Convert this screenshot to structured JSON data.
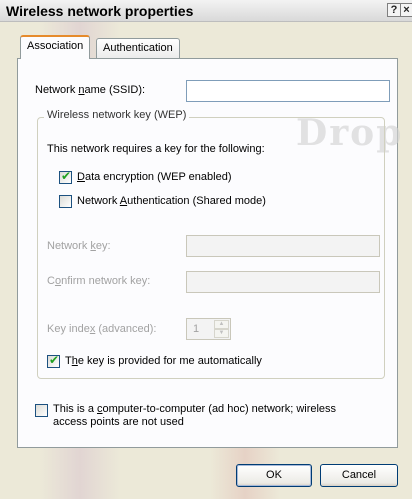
{
  "window": {
    "title": "Wireless network properties",
    "help_button": "?",
    "close_button": "×"
  },
  "watermark": {
    "text": "Drop"
  },
  "tabs": [
    {
      "label": "Association",
      "active": true
    },
    {
      "label": "Authentication",
      "active": false
    }
  ],
  "association": {
    "ssid": {
      "label_pre": "Network ",
      "label_access": "n",
      "label_post": "ame (SSID):",
      "value": ""
    },
    "wep_group": {
      "legend": "Wireless network key (WEP)",
      "requires_text": "This network requires a key for the following:",
      "data_encryption": {
        "label_access": "D",
        "label_post": "ata encryption (WEP enabled)",
        "checked": true
      },
      "network_auth": {
        "label_pre": "Network ",
        "label_access": "A",
        "label_post": "uthentication (Shared mode)",
        "checked": false
      },
      "network_key": {
        "label_pre": "Network ",
        "label_access": "k",
        "label_post": "ey:",
        "value": ""
      },
      "confirm_key": {
        "label_pre": "C",
        "label_access": "o",
        "label_post": "nfirm network key:",
        "value": ""
      },
      "key_index": {
        "label_pre": "Key inde",
        "label_access": "x",
        "label_post": " (advanced):",
        "value": "1"
      },
      "auto_key": {
        "label_pre": "T",
        "label_access": "h",
        "label_post": "e key is provided for me automatically",
        "checked": true
      }
    },
    "adhoc": {
      "label_pre": "This is a ",
      "label_access": "c",
      "label_post": "omputer-to-computer (ad hoc) network; wireless",
      "label_line2": "access points are not used",
      "checked": false
    }
  },
  "buttons": {
    "ok": "OK",
    "cancel": "Cancel"
  }
}
